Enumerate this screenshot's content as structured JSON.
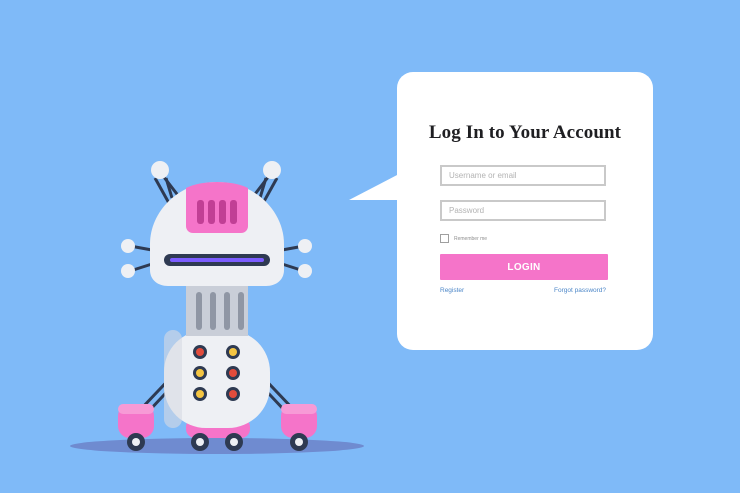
{
  "login": {
    "title": "Log In to Your Account",
    "username_placeholder": "Username or email",
    "password_placeholder": "Password",
    "remember_label": "Remember me",
    "button_label": "LOGIN",
    "register_label": "Register",
    "forgot_label": "Forgot password?"
  },
  "colors": {
    "background": "#7fbaf8",
    "accent_pink": "#f574c9",
    "card": "#ffffff",
    "link": "#4d87c8"
  },
  "illustration": {
    "subject": "robot-icon"
  }
}
